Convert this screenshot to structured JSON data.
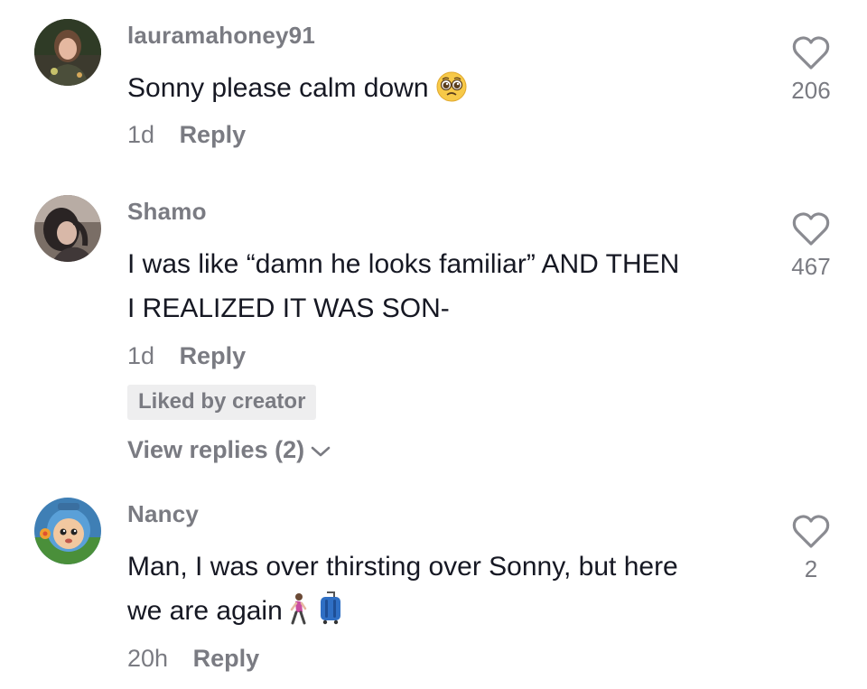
{
  "comments": [
    {
      "username": "lauramahoney91",
      "text": "Sonny please calm down",
      "text_emoji": "pleading-face",
      "time": "1d",
      "reply_label": "Reply",
      "likes": "206",
      "avatar_icon": "user-avatar"
    },
    {
      "username": "Shamo",
      "text_line1": "I was like “damn he looks familiar” AND THEN",
      "text_line2": "I REALIZED IT WAS SON-",
      "time": "1d",
      "reply_label": "Reply",
      "likes": "467",
      "badge": "Liked by creator",
      "view_replies": "View replies (2)",
      "avatar_icon": "user-avatar"
    },
    {
      "username": "Nancy",
      "text_line1": "Man, I was over thirsting over Sonny, but here",
      "text_line2": "we are again",
      "text_emojis": [
        "person-walking",
        "luggage"
      ],
      "time": "20h",
      "reply_label": "Reply",
      "likes": "2",
      "avatar_icon": "cartoon-avatar"
    }
  ],
  "colors": {
    "primary_text": "#161823",
    "secondary_text": "#7a7b82",
    "badge_bg": "#eeeeef"
  }
}
